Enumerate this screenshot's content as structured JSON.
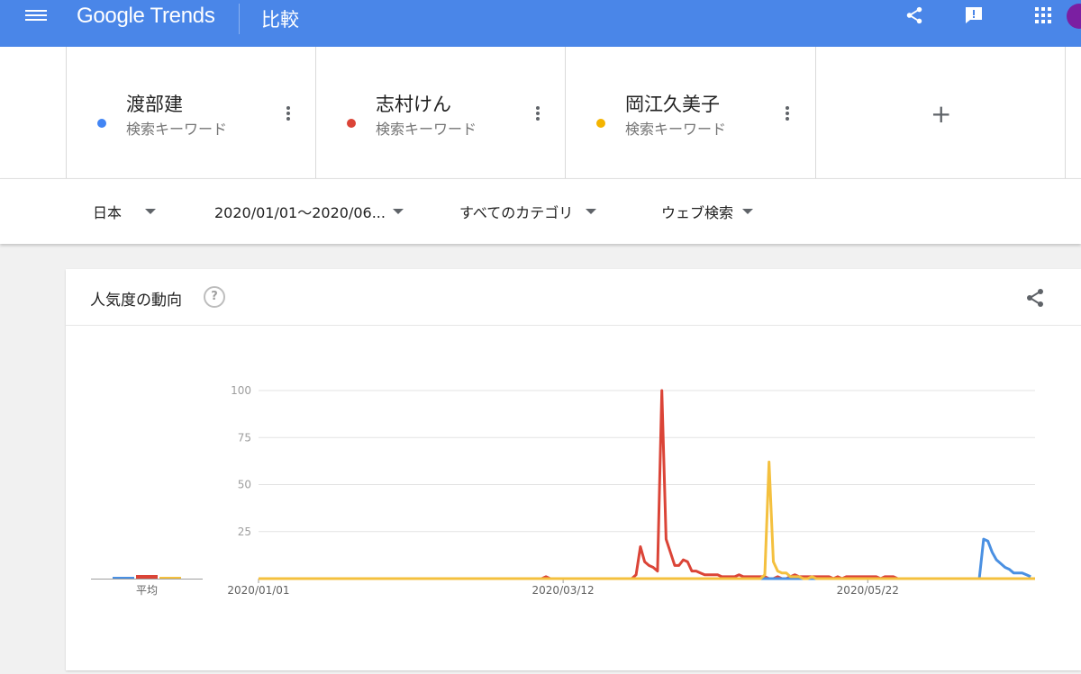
{
  "header": {
    "logo": "Google Trends",
    "page_title": "比較",
    "icons": [
      "menu-icon",
      "share-icon",
      "feedback-icon",
      "apps-icon",
      "avatar"
    ]
  },
  "terms": [
    {
      "name": "渡部建",
      "type": "検索キーワード",
      "color": "#4285f4"
    },
    {
      "name": "志村けん",
      "type": "検索キーワード",
      "color": "#db4437"
    },
    {
      "name": "岡江久美子",
      "type": "検索キーワード",
      "color": "#f4b400"
    }
  ],
  "add_term": "+",
  "filters": {
    "region": "日本",
    "date_range": "2020/01/01～2020/06...",
    "category": "すべてのカテゴリ",
    "search_type": "ウェブ検索"
  },
  "card": {
    "title": "人気度の動向",
    "help": "?"
  },
  "average_label": "平均",
  "chart_data": {
    "type": "line",
    "ylim": [
      0,
      100
    ],
    "y_ticks": [
      "25",
      "50",
      "75",
      "100"
    ],
    "x_ticks": [
      "2020/01/01",
      "2020/03/12",
      "2020/05/22"
    ],
    "x_domain_days": [
      0,
      181
    ],
    "averages": [
      {
        "name": "渡部建",
        "value": 1
      },
      {
        "name": "志村けん",
        "value": 2
      },
      {
        "name": "岡江久美子",
        "value": 1
      }
    ],
    "series": [
      {
        "name": "渡部建",
        "color": "#4a90e2",
        "points": [
          [
            0,
            0
          ],
          [
            168,
            0
          ],
          [
            169,
            21
          ],
          [
            170,
            20
          ],
          [
            171,
            14
          ],
          [
            172,
            10
          ],
          [
            173,
            8
          ],
          [
            174,
            6
          ],
          [
            175,
            5
          ],
          [
            176,
            3
          ],
          [
            177,
            3
          ],
          [
            178,
            3
          ],
          [
            179,
            2
          ],
          [
            180,
            1
          ]
        ]
      },
      {
        "name": "志村けん",
        "color": "#db4437",
        "points": [
          [
            0,
            0
          ],
          [
            66,
            0
          ],
          [
            67,
            1
          ],
          [
            68,
            0
          ],
          [
            87,
            0
          ],
          [
            88,
            2
          ],
          [
            89,
            17
          ],
          [
            90,
            9
          ],
          [
            91,
            7
          ],
          [
            92,
            6
          ],
          [
            93,
            4
          ],
          [
            94,
            100
          ],
          [
            95,
            21
          ],
          [
            96,
            14
          ],
          [
            97,
            7
          ],
          [
            98,
            7
          ],
          [
            99,
            10
          ],
          [
            100,
            9
          ],
          [
            101,
            4
          ],
          [
            102,
            4
          ],
          [
            103,
            3
          ],
          [
            104,
            2
          ],
          [
            105,
            2
          ],
          [
            106,
            2
          ],
          [
            107,
            2
          ],
          [
            108,
            1
          ],
          [
            109,
            1
          ],
          [
            110,
            1
          ],
          [
            111,
            1
          ],
          [
            112,
            2
          ],
          [
            113,
            1
          ],
          [
            114,
            1
          ],
          [
            115,
            1
          ],
          [
            116,
            1
          ],
          [
            117,
            1
          ],
          [
            118,
            1
          ],
          [
            119,
            0
          ],
          [
            120,
            0
          ],
          [
            121,
            1
          ],
          [
            122,
            0
          ],
          [
            123,
            0
          ],
          [
            124,
            1
          ],
          [
            125,
            2
          ],
          [
            126,
            1
          ],
          [
            127,
            1
          ],
          [
            128,
            1
          ],
          [
            129,
            1
          ],
          [
            130,
            1
          ],
          [
            131,
            1
          ],
          [
            132,
            1
          ],
          [
            133,
            1
          ],
          [
            134,
            0
          ],
          [
            135,
            1
          ],
          [
            136,
            0
          ],
          [
            137,
            1
          ],
          [
            138,
            1
          ],
          [
            139,
            1
          ],
          [
            140,
            1
          ],
          [
            141,
            1
          ],
          [
            142,
            1
          ],
          [
            143,
            1
          ],
          [
            144,
            1
          ],
          [
            145,
            0
          ],
          [
            146,
            1
          ],
          [
            147,
            1
          ],
          [
            148,
            1
          ],
          [
            149,
            0
          ],
          [
            150,
            0
          ],
          [
            181,
            0
          ]
        ]
      },
      {
        "name": "岡江久美子",
        "color": "#f4c03e",
        "points": [
          [
            0,
            0
          ],
          [
            117,
            0
          ],
          [
            118,
            2
          ],
          [
            119,
            62
          ],
          [
            120,
            9
          ],
          [
            121,
            4
          ],
          [
            122,
            3
          ],
          [
            123,
            3
          ],
          [
            124,
            1
          ],
          [
            125,
            1
          ],
          [
            126,
            1
          ],
          [
            127,
            0
          ],
          [
            128,
            0
          ],
          [
            129,
            1
          ],
          [
            130,
            0
          ],
          [
            181,
            0
          ]
        ]
      }
    ]
  }
}
